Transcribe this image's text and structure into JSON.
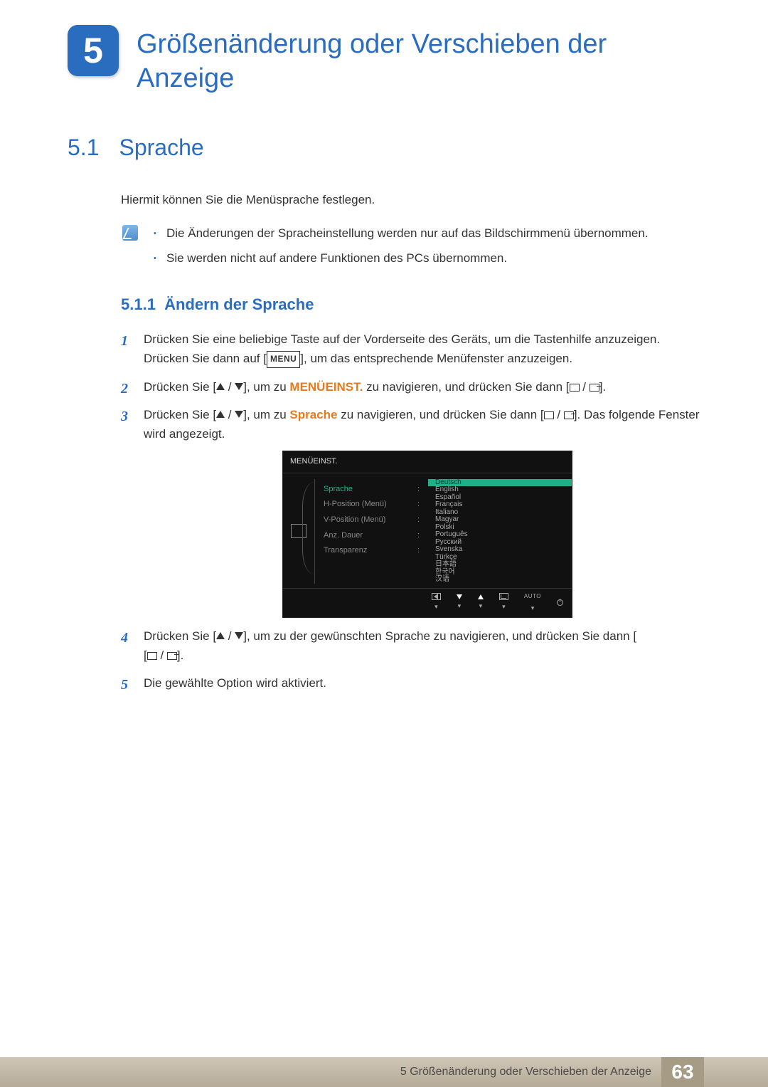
{
  "chapter": {
    "number": "5",
    "title": "Größenänderung oder Verschieben der Anzeige"
  },
  "section": {
    "number": "5.1",
    "title": "Sprache"
  },
  "intro": "Hiermit können Sie die Menüsprache festlegen.",
  "notes": [
    "Die Änderungen der Spracheinstellung werden nur auf das Bildschirmmenü übernommen.",
    "Sie werden nicht auf andere Funktionen des PCs übernommen."
  ],
  "subsection": {
    "number": "5.1.1",
    "title": "Ändern der Sprache"
  },
  "steps": {
    "s1a": "Drücken Sie eine beliebige Taste auf der Vorderseite des Geräts, um die Tastenhilfe anzuzeigen. Drücken Sie dann auf [",
    "s1_btn": "MENU",
    "s1b": "], um das entsprechende Menüfenster anzuzeigen.",
    "s2a": "Drücken Sie [",
    "s2b": "], um zu ",
    "s2_kw": "MENÜEINST.",
    "s2c": " zu navigieren, und drücken Sie dann [",
    "s2d": "].",
    "s3a": "Drücken Sie [",
    "s3b": "], um zu ",
    "s3_kw": "Sprache",
    "s3c": " zu navigieren, und drücken Sie dann [",
    "s3d": "]. Das folgende Fenster wird angezeigt.",
    "s4a": "Drücken Sie [",
    "s4b": "], um zu der gewünschten Sprache zu navigieren, und drücken Sie dann [",
    "s4c": "].",
    "s5": "Die gewählte Option wird aktiviert."
  },
  "osd": {
    "title": "MENÜEINST.",
    "menu": [
      "Sprache",
      "H-Position (Menü)",
      "V-Position (Menü)",
      "Anz. Dauer",
      "Transparenz"
    ],
    "languages": [
      "Deutsch",
      "English",
      "Español",
      "Français",
      "Italiano",
      "Magyar",
      "Polski",
      "Português",
      "Русский",
      "Svenska",
      "Türkçe",
      "日本語",
      "한국어",
      "汉语"
    ],
    "nav_auto": "AUTO"
  },
  "footer": {
    "text": "5 Größenänderung oder Verschieben der Anzeige",
    "page": "63"
  }
}
